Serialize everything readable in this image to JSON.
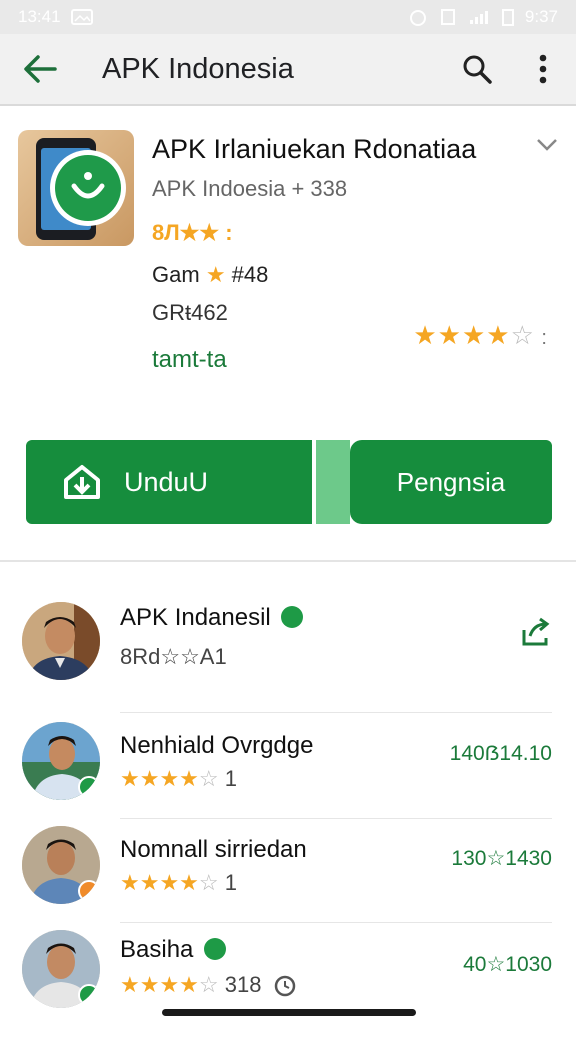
{
  "status": {
    "time": "13:41",
    "right_time": "9:37"
  },
  "toolbar": {
    "title": "APK Indonesia",
    "back_icon": "arrow-back-icon",
    "search_icon": "search-icon",
    "more_icon": "more-vert-icon"
  },
  "app": {
    "title": "APK Irlaniuekan Rdonatiaa",
    "developer": "APK Indoesia",
    "developer_count": "+ 338",
    "rating_text": "8Л",
    "game_label": "Gam",
    "game_value": "#48",
    "size": "GRŧ462",
    "tag": "tamt-ta",
    "stars": "4"
  },
  "buttons": {
    "install": "UnduU",
    "open": "Pengnsia"
  },
  "reviews": [
    {
      "name": "APK Indanesil",
      "sub": "8Rd☆☆A1",
      "right": ""
    },
    {
      "name": "Nenhiald Ovrgdge",
      "sub_count": "1",
      "stars": "4",
      "right": "140ẞ14.10"
    },
    {
      "name": "Nomnall sirriedan",
      "sub_count": "1",
      "stars": "4",
      "right": "130☆1430"
    },
    {
      "name": "Basiha",
      "sub_count": "318",
      "stars": "4",
      "right": "40☆1030"
    }
  ],
  "colors": {
    "accent": "#168d3d",
    "star": "#f5a623",
    "text_green": "#1b7a3a"
  }
}
